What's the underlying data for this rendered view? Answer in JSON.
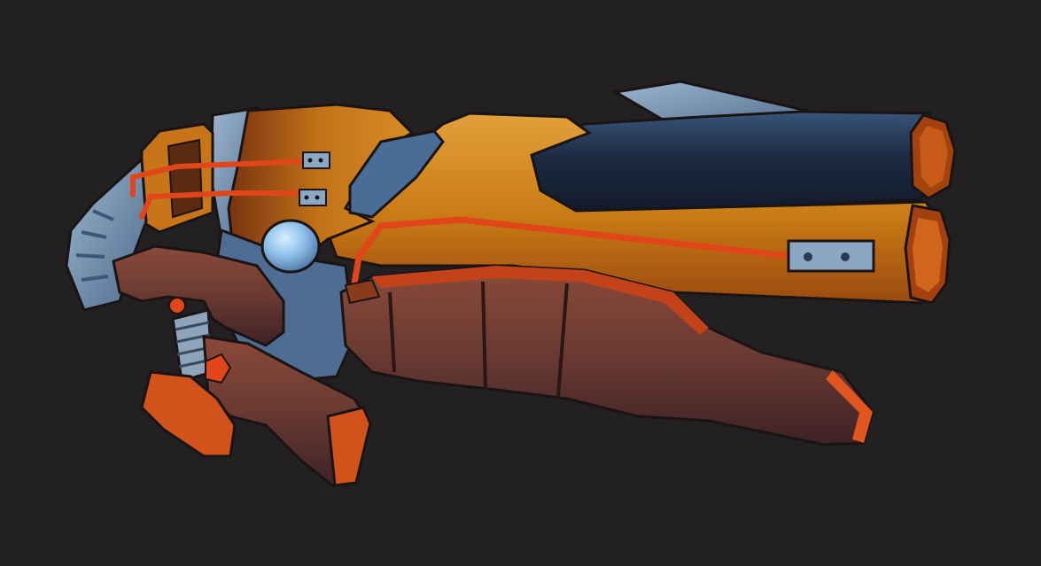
{
  "image": {
    "subject": "stylized-sci-fi-blaster-3d-render",
    "colors": {
      "background": "#232021",
      "orange_body": "#d98a1e",
      "orange_light": "#e8a23a",
      "orange_dark": "#b35a12",
      "brown_grip": "#6b3f36",
      "brown_dark": "#4a2a26",
      "accent_red": "#e0461a",
      "steel_blue": "#5f7fa3",
      "steel_light": "#8aa7c4",
      "navy_barrel": "#1f2c44",
      "orb": "#8fc1ea",
      "outline": "#1a1415"
    }
  }
}
